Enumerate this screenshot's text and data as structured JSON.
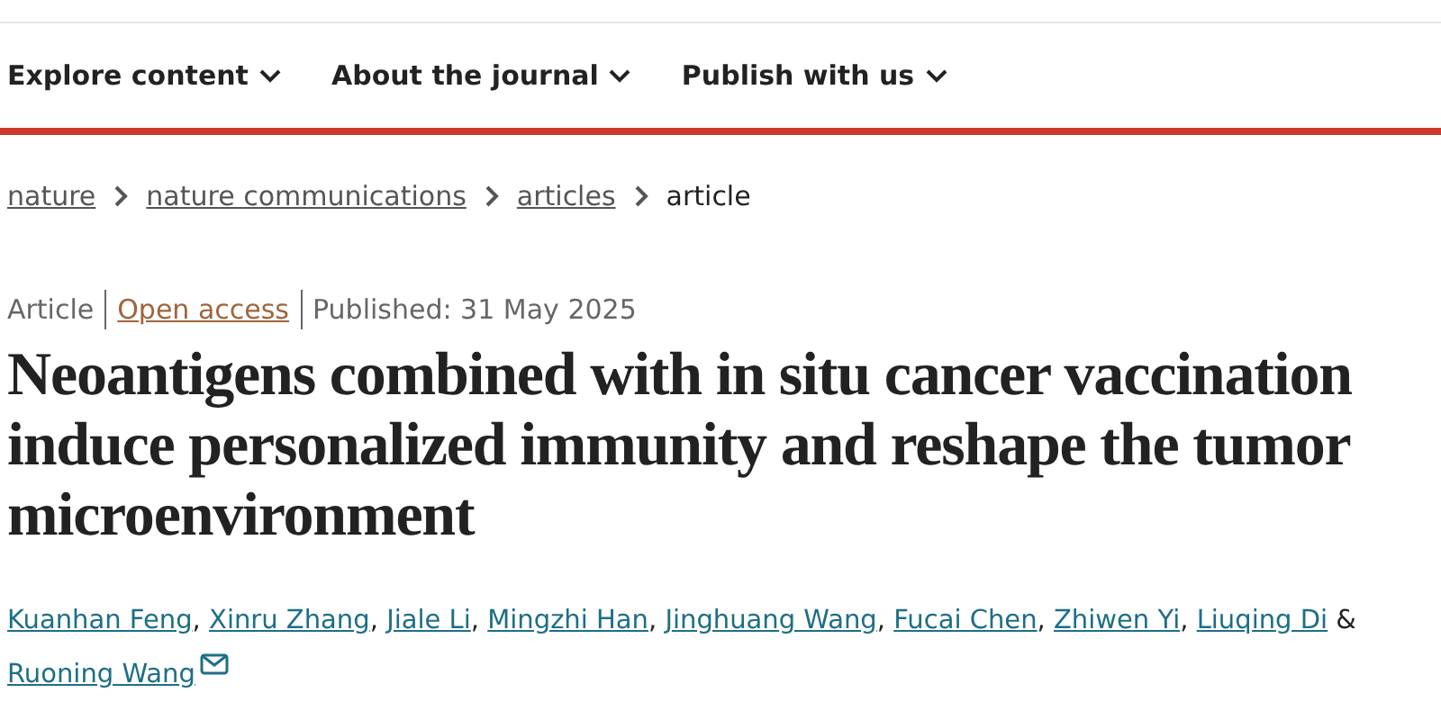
{
  "nav": {
    "items": [
      {
        "label": "Explore content"
      },
      {
        "label": "About the journal"
      },
      {
        "label": "Publish with us"
      }
    ]
  },
  "breadcrumb": [
    {
      "label": "nature",
      "link": true
    },
    {
      "label": "nature communications",
      "link": true
    },
    {
      "label": "articles",
      "link": true
    },
    {
      "label": "article",
      "link": false
    }
  ],
  "meta": {
    "type": "Article",
    "access": "Open access",
    "published": "Published: 31 May 2025"
  },
  "title": "Neoantigens combined with in situ cancer vaccination induce personalized immunity and reshape the tumor microenvironment",
  "authors": [
    {
      "name": "Kuanhan Feng",
      "after": ","
    },
    {
      "name": "Xinru Zhang",
      "after": ","
    },
    {
      "name": "Jiale Li",
      "after": ","
    },
    {
      "name": "Mingzhi Han",
      "after": ","
    },
    {
      "name": "Jinghuang Wang",
      "after": ","
    },
    {
      "name": "Fucai Chen",
      "after": ","
    },
    {
      "name": "Zhiwen Yi",
      "after": ","
    },
    {
      "name": "Liuqing Di",
      "after": "&"
    },
    {
      "name": "Ruoning Wang",
      "email": true
    }
  ]
}
